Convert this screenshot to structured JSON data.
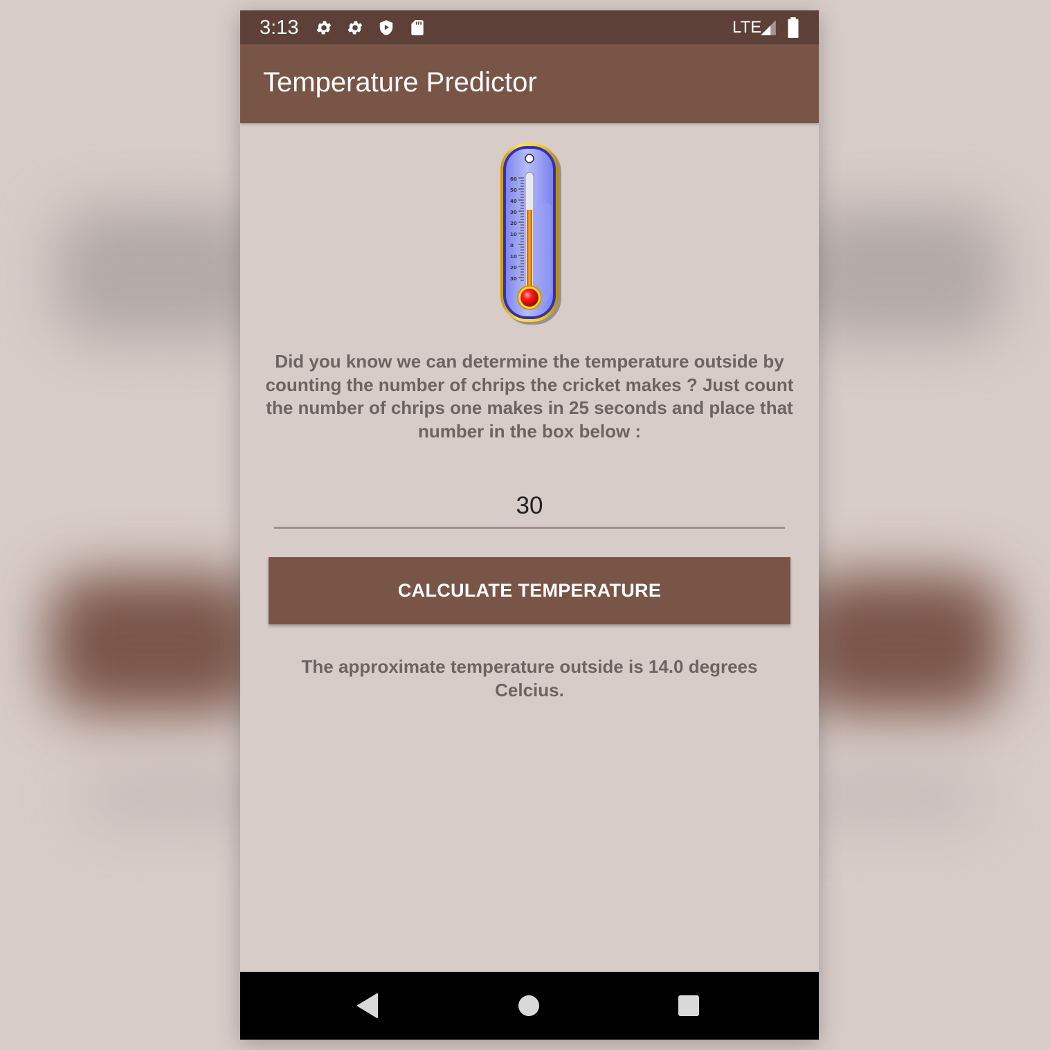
{
  "status_bar": {
    "time": "3:13",
    "network": "LTE",
    "icons": [
      "gear-icon",
      "gear-icon",
      "shield-play-icon",
      "sd-card-icon",
      "signal-icon",
      "battery-icon"
    ]
  },
  "app_bar": {
    "title": "Temperature Predictor"
  },
  "illustration": {
    "icon": "thermometer-icon"
  },
  "main": {
    "description": "Did you know we can determine the temperature outside by counting the number of chrips the cricket makes ? Just count the number of chrips one makes in 25 seconds and place that number in the box below :",
    "chirp_input_value": "30",
    "calculate_label": "CALCULATE TEMPERATURE",
    "result_text": "The approximate temperature outside is 14.0 degrees Celcius."
  },
  "nav_bar": {
    "buttons": [
      "back-icon",
      "home-icon",
      "recents-icon"
    ]
  },
  "colors": {
    "status_bar": "#5d4037",
    "primary": "#795548",
    "background": "#d7ccc8",
    "text_secondary": "#6d6461"
  }
}
